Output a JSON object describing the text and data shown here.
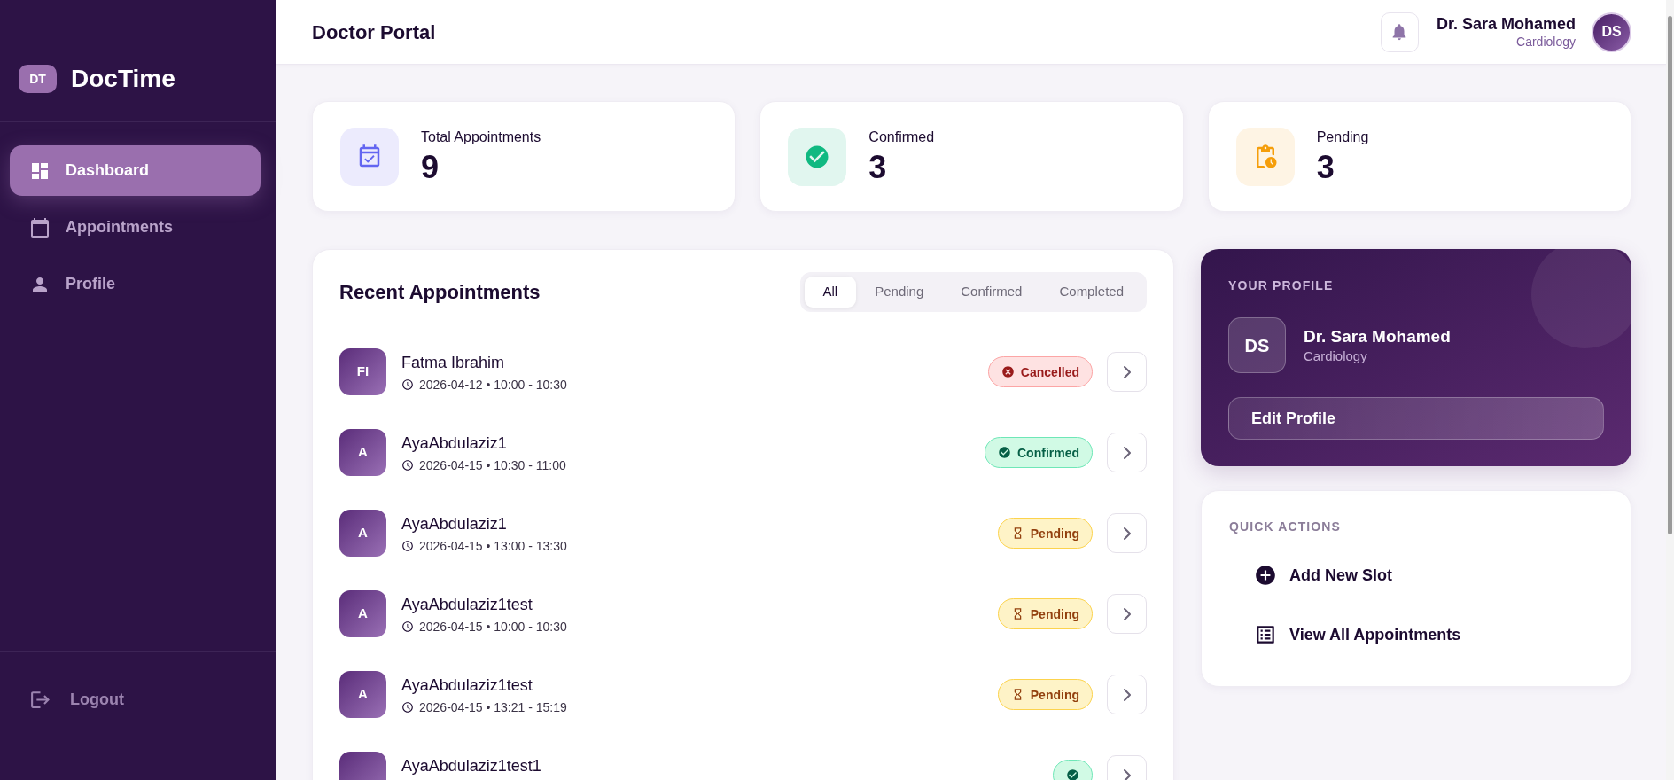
{
  "sidebar": {
    "logo": {
      "initials": "DT",
      "name": "DocTime"
    },
    "items": [
      {
        "label": "Dashboard",
        "selected": true
      },
      {
        "label": "Appointments",
        "selected": false
      },
      {
        "label": "Profile",
        "selected": false
      }
    ],
    "logout": "Logout"
  },
  "header": {
    "title": "Doctor Portal",
    "user": {
      "name": "Dr. Sara Mohamed",
      "specialty": "Cardiology",
      "initials": "DS"
    }
  },
  "stats": [
    {
      "kind": "total",
      "label": "Total Appointments",
      "value": "9"
    },
    {
      "kind": "confirmed",
      "label": "Confirmed",
      "value": "3"
    },
    {
      "kind": "pending",
      "label": "Pending",
      "value": "3"
    }
  ],
  "recent_appointments": {
    "title": "Recent Appointments",
    "filters": [
      {
        "label": "All",
        "selected": true
      },
      {
        "label": "Pending",
        "selected": false
      },
      {
        "label": "Confirmed",
        "selected": false
      },
      {
        "label": "Completed",
        "selected": false
      }
    ],
    "rows": [
      {
        "initials": "FI",
        "name": "Fatma Ibrahim",
        "time": "2026-04-12 • 10:00 - 10:30",
        "kind": "cancelled",
        "status": "Cancelled"
      },
      {
        "initials": "A",
        "name": "AyaAbdulaziz1",
        "time": "2026-04-15 • 10:30 - 11:00",
        "kind": "confirmed",
        "status": "Confirmed"
      },
      {
        "initials": "A",
        "name": "AyaAbdulaziz1",
        "time": "2026-04-15 • 13:00 - 13:30",
        "kind": "pending",
        "status": "Pending"
      },
      {
        "initials": "A",
        "name": "AyaAbdulaziz1test",
        "time": "2026-04-15 • 10:00 - 10:30",
        "kind": "pending",
        "status": "Pending"
      },
      {
        "initials": "A",
        "name": "AyaAbdulaziz1test",
        "time": "2026-04-15 • 13:21 - 15:19",
        "kind": "pending",
        "status": "Pending"
      },
      {
        "name": "AyaAbdulaziz1test1",
        "kind": "confirmed"
      }
    ]
  },
  "profile_card": {
    "heading": "YOUR PROFILE",
    "initials": "DS",
    "name": "Dr. Sara Mohamed",
    "specialty": "Cardiology",
    "button": "Edit Profile"
  },
  "quick_actions": {
    "heading": "QUICK ACTIONS",
    "items": [
      "Add New Slot",
      "View All Appointments"
    ]
  }
}
